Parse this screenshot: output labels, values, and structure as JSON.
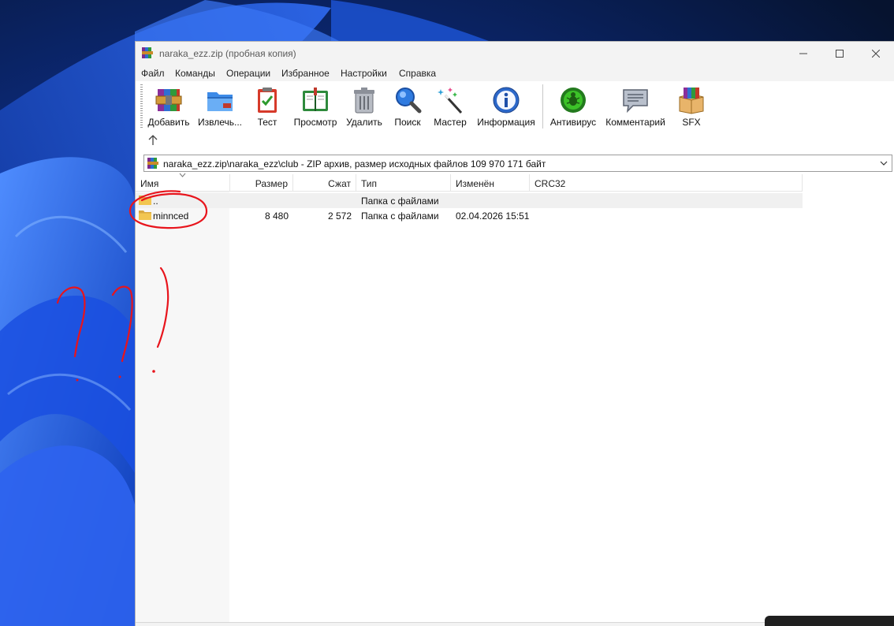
{
  "window": {
    "title": "naraka_ezz.zip (пробная копия)"
  },
  "menu": {
    "items": [
      "Файл",
      "Команды",
      "Операции",
      "Избранное",
      "Настройки",
      "Справка"
    ]
  },
  "toolbar": {
    "buttons": [
      {
        "label": "Добавить",
        "icon": "add-archive-icon"
      },
      {
        "label": "Извлечь...",
        "icon": "extract-icon"
      },
      {
        "label": "Тест",
        "icon": "test-icon"
      },
      {
        "label": "Просмотр",
        "icon": "view-icon"
      },
      {
        "label": "Удалить",
        "icon": "delete-icon"
      },
      {
        "label": "Поиск",
        "icon": "search-icon"
      },
      {
        "label": "Мастер",
        "icon": "wizard-icon"
      },
      {
        "label": "Информация",
        "icon": "info-icon"
      },
      {
        "label": "Антивирус",
        "icon": "antivirus-icon"
      },
      {
        "label": "Комментарий",
        "icon": "comment-icon"
      },
      {
        "label": "SFX",
        "icon": "sfx-icon"
      }
    ]
  },
  "address": {
    "path": "naraka_ezz.zip\\naraka_ezz\\club - ZIP архив, размер исходных файлов 109 970 171 байт"
  },
  "file_list": {
    "columns": [
      "Имя",
      "Размер",
      "Сжат",
      "Тип",
      "Изменён",
      "CRC32"
    ],
    "rows": [
      {
        "name": "..",
        "size": "",
        "packed": "",
        "type": "Папка с файлами",
        "modified": "",
        "crc": ""
      },
      {
        "name": "minnced",
        "size": "8 480",
        "packed": "2 572",
        "type": "Папка с файлами",
        "modified": "02.04.2026 15:51",
        "crc": ""
      }
    ]
  },
  "colors": {
    "annotation": "#e8141c",
    "selection": "#f0f0f0",
    "wallpaper_blue": "#1f5fe8"
  }
}
